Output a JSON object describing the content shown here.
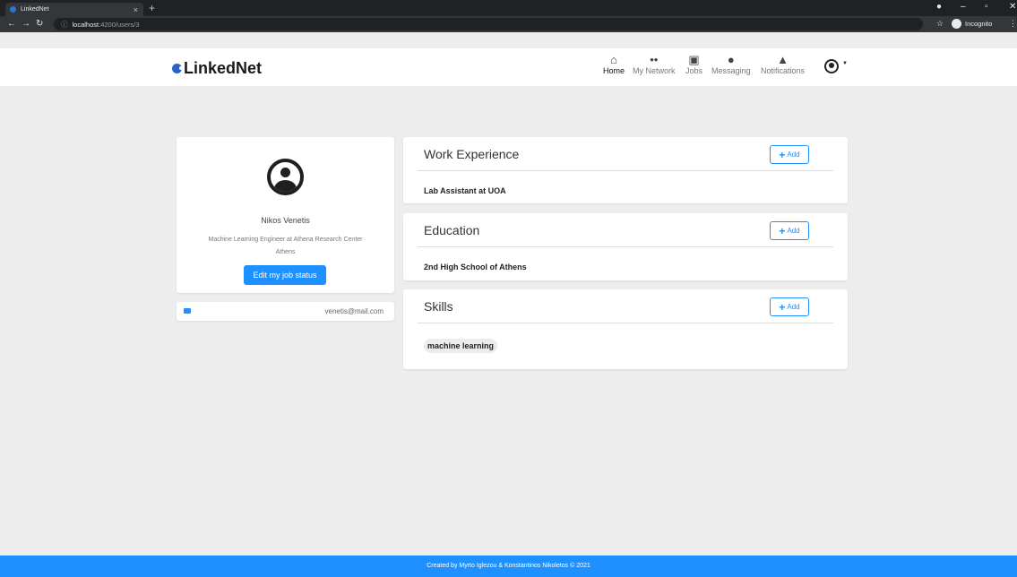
{
  "browser": {
    "tab_title": "LinkedNet",
    "tab_close": "×",
    "new_tab": "+",
    "url_host": "localhost",
    "url_path": ":4200/users/3",
    "incognito_label": "Incognito",
    "win_min": "–",
    "win_max": "▫",
    "win_close": "✕"
  },
  "navbar": {
    "logo_text": "LinkedNet",
    "items": [
      {
        "label": "Home",
        "icon": "home-icon"
      },
      {
        "label": "My Network",
        "icon": "people-icon"
      },
      {
        "label": "Jobs",
        "icon": "briefcase-icon"
      },
      {
        "label": "Messaging",
        "icon": "chat-icon"
      },
      {
        "label": "Notifications",
        "icon": "bell-icon"
      }
    ]
  },
  "profile": {
    "name": "Nikos Venetis",
    "title": "Machine Learning Engineer at Athena Research Center",
    "location": "Athens",
    "edit_button": "Edit my job status",
    "email": "venetis@mail.com"
  },
  "sections": {
    "work": {
      "title": "Work Experience",
      "add_label": "Add",
      "items": [
        "Lab Assistant at UOA"
      ]
    },
    "education": {
      "title": "Education",
      "add_label": "Add",
      "items": [
        "2nd High School of Athens"
      ]
    },
    "skills": {
      "title": "Skills",
      "add_label": "Add",
      "items": [
        "machine learning"
      ]
    }
  },
  "footer": {
    "text": "Created by Myrto Iglezou & Konstantinos Nikoletos © 2021"
  },
  "colors": {
    "accent": "#1e90ff",
    "background": "#ededed"
  }
}
